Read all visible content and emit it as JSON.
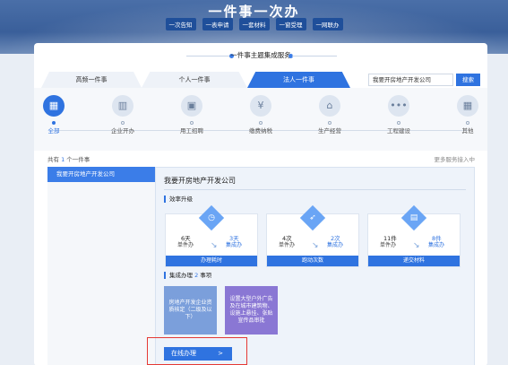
{
  "header": {
    "title": "一件事一次办",
    "pills": [
      "一次告知",
      "一表申请",
      "一套材料",
      "一窗受理",
      "一网联办"
    ]
  },
  "service": {
    "title": "一件事主题集成服务",
    "tabs": [
      "高频一件事",
      "个人一件事",
      "法人一件事"
    ],
    "active_tab": "法人一件事",
    "search_value": "我要开房地产开发公司",
    "search_button": "搜索"
  },
  "categories": [
    {
      "label": "全部",
      "icon": "grid-icon",
      "glyph": "▦",
      "active": true
    },
    {
      "label": "企业开办",
      "icon": "building-icon",
      "glyph": "▥",
      "active": false
    },
    {
      "label": "用工招聘",
      "icon": "briefcase-icon",
      "glyph": "▣",
      "active": false
    },
    {
      "label": "缴费纳税",
      "icon": "tax-icon",
      "glyph": "¥",
      "active": false
    },
    {
      "label": "生产经营",
      "icon": "factory-icon",
      "glyph": "⌂",
      "active": false
    },
    {
      "label": "工程建设",
      "icon": "dots-icon",
      "glyph": "•••",
      "active": false
    },
    {
      "label": "其他",
      "icon": "other-grid-icon",
      "glyph": "▦",
      "active": false
    }
  ],
  "result": {
    "total_prefix": "共有",
    "total_count": "1",
    "total_suffix": "个一件事",
    "more": "更多服务接入中",
    "list_item": "我要开房地产开发公司"
  },
  "detail": {
    "title": "我要开房地产开发公司",
    "efficiency_title": "效率升级",
    "metrics": [
      {
        "icon": "clock-icon",
        "glyph": "◷",
        "before_num": "6天",
        "before_label": "单件办",
        "after_num": "3天",
        "after_label": "集成办",
        "footer": "办理耗时"
      },
      {
        "icon": "runner-icon",
        "glyph": "➶",
        "before_num": "4次",
        "before_label": "单件办",
        "after_num": "2次",
        "after_label": "集成办",
        "footer": "跑动次数"
      },
      {
        "icon": "document-icon",
        "glyph": "▤",
        "before_num": "11件",
        "before_label": "单件办",
        "after_num": "8件",
        "after_label": "集成办",
        "footer": "递交材料"
      }
    ],
    "integrated_prefix": "集成办理",
    "integrated_count": "2",
    "integrated_suffix": "事项",
    "tiles": [
      {
        "text": "房地产开发企业资质核定（二级及以下）",
        "color": "#7b9fdb"
      },
      {
        "text": "设置大型户外广告及在城市建筑物、设施上悬挂、张贴宣传品审批",
        "color": "#8a77d4"
      }
    ],
    "online_button": "在线办理",
    "online_chevron": ">"
  }
}
